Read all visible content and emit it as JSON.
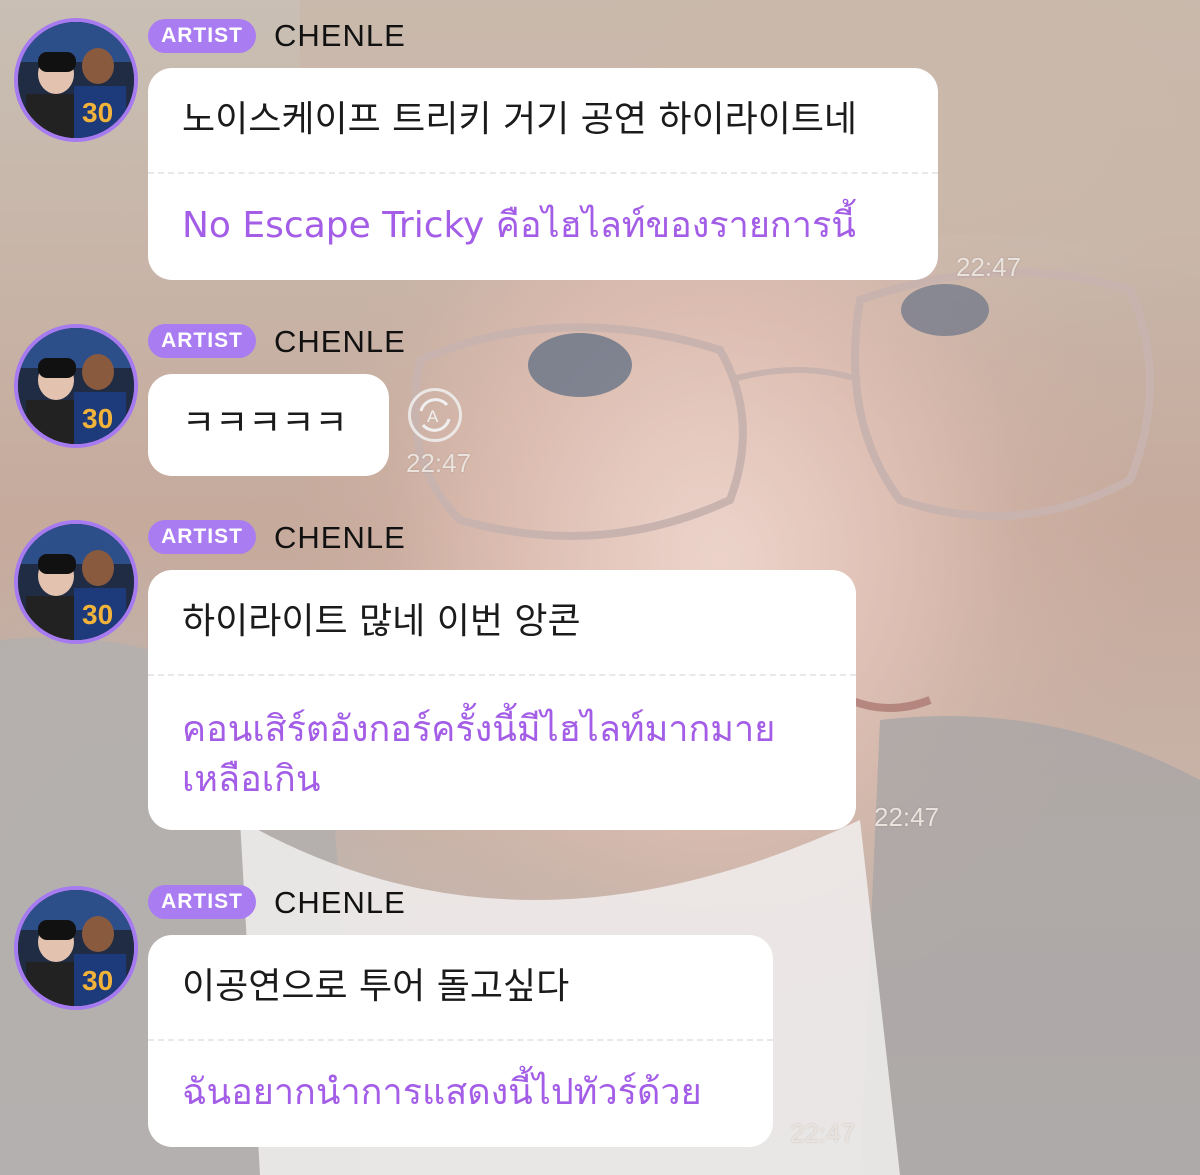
{
  "messages": [
    {
      "badge": "ARTIST",
      "name": "CHENLE",
      "original": "노이스케이프 트리키 거기 공연 하이라이트네",
      "translation": "No Escape Tricky คือไฮไลท์ของรายการนี้",
      "time": "22:47"
    },
    {
      "badge": "ARTIST",
      "name": "CHENLE",
      "original": "ㅋㅋㅋㅋㅋ",
      "translation": "",
      "time": "22:47",
      "translate_icon": "translate-icon"
    },
    {
      "badge": "ARTIST",
      "name": "CHENLE",
      "original": "하이라이트 많네 이번 앙콘",
      "translation_line1": "คอนเสิร์ตอังกอร์ครั้งนี้มีไฮไลท์มากมาย",
      "translation_line2": "เหลือเกิน",
      "time": "22:47"
    },
    {
      "badge": "ARTIST",
      "name": "CHENLE",
      "original": "이공연으로 투어 돌고싶다",
      "translation": "ฉันอยากนำการแสดงนี้ไปทัวร์ด้วย",
      "time": "22:47"
    }
  ],
  "colors": {
    "badge": "#a97cf2",
    "avatar_ring": "#a77bf0",
    "translation_text": "#a35de6",
    "bubble": "#ffffff"
  }
}
